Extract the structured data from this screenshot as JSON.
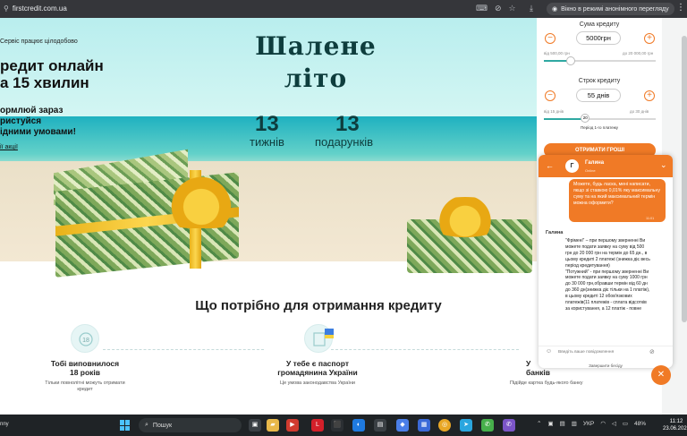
{
  "browser": {
    "url": "firstcredit.com.ua",
    "incognito_label": "Вікно в режимі анонімного перегляду"
  },
  "hero": {
    "tagline": "Сервіс працює цілодобово",
    "headline": "редит онлайн\nа 15 хвилин",
    "subhead": "ормлюй зараз\nристуйся\nідними умовами!",
    "promo_link": "ії акції",
    "promo_title_line1": "Шалене",
    "promo_title_line2": "літо",
    "weeks_number": "13",
    "weeks_label": "тижнів",
    "gifts_number": "13",
    "gifts_label": "подарунків"
  },
  "calculator": {
    "amount_label": "Сума кредиту",
    "amount_value": "5000грн",
    "amount_min": "від 500,00 грн",
    "amount_max": "до 20 000,00 грн",
    "amount_fraction": 0.24,
    "term_label": "Строк кредиту",
    "term_value": "55 днів",
    "term_min": "від 15 днів",
    "term_max": "до 30 днів",
    "term_knob_value": "20",
    "term_fraction": 0.37,
    "payment_period": "Період 1-го платежу",
    "get_money_button": "ОТРИМАТИ ГРОШІ"
  },
  "requirements": {
    "title": "Що потрібно для отримання кредиту",
    "items": [
      {
        "title": "Тобі виповнилося\n18 років",
        "desc": "Тільки повнолітні можуть отримати\nкредит"
      },
      {
        "title": "У тебе є паспорт\nгромадянина України",
        "desc": "Це умова законодавства України"
      },
      {
        "title": "У\nбанків",
        "desc": "Підійде картка будь-якого банку"
      }
    ]
  },
  "chat": {
    "agent_name": "Галина",
    "agent_initial": "Г",
    "agent_subtitle": "Оnline",
    "user_message": "Можете, будь ласка, мені написати, якщо зі ставкою 0,01% яку максимальну суму та на який максимальний термін можна оформити?",
    "user_time": "11:01",
    "bot_name": "Галина",
    "bot_message": "\"Фрімені\" – при першому зверненні Ви можете подати заявку на суму від 500 грн до 20 000 грн на термін до 65 дн., в цьому кредиті 2 платежі (знижка діє весь період кредитування)\n\"Потужний\" - при першому зверненні Ви можете подати заявку на суму 1000 грн до 30 000 грн,обравши термін від 60 дн до 360 дн(знижка діє тільки на 1 платіж), в цьому кредиті 12 обов'язкових платежів(11 платежів - сплата відсотків за користування, а 12 платіж - повне",
    "input_placeholder": "Введіть ваше повідомлення",
    "end_chat": "Завершити бесіду"
  },
  "taskbar": {
    "left_text": "nny",
    "search_placeholder": "Пошук",
    "language": "УКР",
    "battery": "48%",
    "time": "11:12",
    "date": "23.06.2026"
  },
  "colors": {
    "accent": "#f07a26",
    "teal": "#2fa8a2",
    "dark_green": "#0e3d3d"
  }
}
